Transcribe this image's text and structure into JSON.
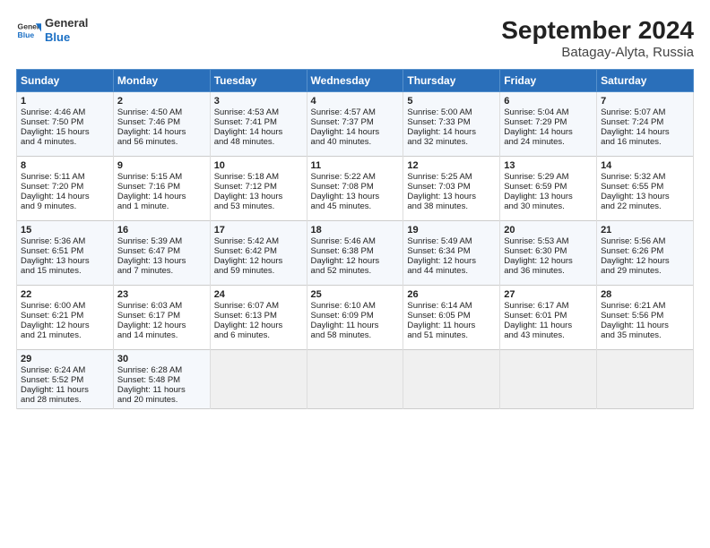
{
  "header": {
    "logo_general": "General",
    "logo_blue": "Blue",
    "month_title": "September 2024",
    "location": "Batagay-Alyta, Russia"
  },
  "weekdays": [
    "Sunday",
    "Monday",
    "Tuesday",
    "Wednesday",
    "Thursday",
    "Friday",
    "Saturday"
  ],
  "weeks": [
    [
      {
        "day": "1",
        "lines": [
          "Sunrise: 4:46 AM",
          "Sunset: 7:50 PM",
          "Daylight: 15 hours",
          "and 4 minutes."
        ]
      },
      {
        "day": "2",
        "lines": [
          "Sunrise: 4:50 AM",
          "Sunset: 7:46 PM",
          "Daylight: 14 hours",
          "and 56 minutes."
        ]
      },
      {
        "day": "3",
        "lines": [
          "Sunrise: 4:53 AM",
          "Sunset: 7:41 PM",
          "Daylight: 14 hours",
          "and 48 minutes."
        ]
      },
      {
        "day": "4",
        "lines": [
          "Sunrise: 4:57 AM",
          "Sunset: 7:37 PM",
          "Daylight: 14 hours",
          "and 40 minutes."
        ]
      },
      {
        "day": "5",
        "lines": [
          "Sunrise: 5:00 AM",
          "Sunset: 7:33 PM",
          "Daylight: 14 hours",
          "and 32 minutes."
        ]
      },
      {
        "day": "6",
        "lines": [
          "Sunrise: 5:04 AM",
          "Sunset: 7:29 PM",
          "Daylight: 14 hours",
          "and 24 minutes."
        ]
      },
      {
        "day": "7",
        "lines": [
          "Sunrise: 5:07 AM",
          "Sunset: 7:24 PM",
          "Daylight: 14 hours",
          "and 16 minutes."
        ]
      }
    ],
    [
      {
        "day": "8",
        "lines": [
          "Sunrise: 5:11 AM",
          "Sunset: 7:20 PM",
          "Daylight: 14 hours",
          "and 9 minutes."
        ]
      },
      {
        "day": "9",
        "lines": [
          "Sunrise: 5:15 AM",
          "Sunset: 7:16 PM",
          "Daylight: 14 hours",
          "and 1 minute."
        ]
      },
      {
        "day": "10",
        "lines": [
          "Sunrise: 5:18 AM",
          "Sunset: 7:12 PM",
          "Daylight: 13 hours",
          "and 53 minutes."
        ]
      },
      {
        "day": "11",
        "lines": [
          "Sunrise: 5:22 AM",
          "Sunset: 7:08 PM",
          "Daylight: 13 hours",
          "and 45 minutes."
        ]
      },
      {
        "day": "12",
        "lines": [
          "Sunrise: 5:25 AM",
          "Sunset: 7:03 PM",
          "Daylight: 13 hours",
          "and 38 minutes."
        ]
      },
      {
        "day": "13",
        "lines": [
          "Sunrise: 5:29 AM",
          "Sunset: 6:59 PM",
          "Daylight: 13 hours",
          "and 30 minutes."
        ]
      },
      {
        "day": "14",
        "lines": [
          "Sunrise: 5:32 AM",
          "Sunset: 6:55 PM",
          "Daylight: 13 hours",
          "and 22 minutes."
        ]
      }
    ],
    [
      {
        "day": "15",
        "lines": [
          "Sunrise: 5:36 AM",
          "Sunset: 6:51 PM",
          "Daylight: 13 hours",
          "and 15 minutes."
        ]
      },
      {
        "day": "16",
        "lines": [
          "Sunrise: 5:39 AM",
          "Sunset: 6:47 PM",
          "Daylight: 13 hours",
          "and 7 minutes."
        ]
      },
      {
        "day": "17",
        "lines": [
          "Sunrise: 5:42 AM",
          "Sunset: 6:42 PM",
          "Daylight: 12 hours",
          "and 59 minutes."
        ]
      },
      {
        "day": "18",
        "lines": [
          "Sunrise: 5:46 AM",
          "Sunset: 6:38 PM",
          "Daylight: 12 hours",
          "and 52 minutes."
        ]
      },
      {
        "day": "19",
        "lines": [
          "Sunrise: 5:49 AM",
          "Sunset: 6:34 PM",
          "Daylight: 12 hours",
          "and 44 minutes."
        ]
      },
      {
        "day": "20",
        "lines": [
          "Sunrise: 5:53 AM",
          "Sunset: 6:30 PM",
          "Daylight: 12 hours",
          "and 36 minutes."
        ]
      },
      {
        "day": "21",
        "lines": [
          "Sunrise: 5:56 AM",
          "Sunset: 6:26 PM",
          "Daylight: 12 hours",
          "and 29 minutes."
        ]
      }
    ],
    [
      {
        "day": "22",
        "lines": [
          "Sunrise: 6:00 AM",
          "Sunset: 6:21 PM",
          "Daylight: 12 hours",
          "and 21 minutes."
        ]
      },
      {
        "day": "23",
        "lines": [
          "Sunrise: 6:03 AM",
          "Sunset: 6:17 PM",
          "Daylight: 12 hours",
          "and 14 minutes."
        ]
      },
      {
        "day": "24",
        "lines": [
          "Sunrise: 6:07 AM",
          "Sunset: 6:13 PM",
          "Daylight: 12 hours",
          "and 6 minutes."
        ]
      },
      {
        "day": "25",
        "lines": [
          "Sunrise: 6:10 AM",
          "Sunset: 6:09 PM",
          "Daylight: 11 hours",
          "and 58 minutes."
        ]
      },
      {
        "day": "26",
        "lines": [
          "Sunrise: 6:14 AM",
          "Sunset: 6:05 PM",
          "Daylight: 11 hours",
          "and 51 minutes."
        ]
      },
      {
        "day": "27",
        "lines": [
          "Sunrise: 6:17 AM",
          "Sunset: 6:01 PM",
          "Daylight: 11 hours",
          "and 43 minutes."
        ]
      },
      {
        "day": "28",
        "lines": [
          "Sunrise: 6:21 AM",
          "Sunset: 5:56 PM",
          "Daylight: 11 hours",
          "and 35 minutes."
        ]
      }
    ],
    [
      {
        "day": "29",
        "lines": [
          "Sunrise: 6:24 AM",
          "Sunset: 5:52 PM",
          "Daylight: 11 hours",
          "and 28 minutes."
        ]
      },
      {
        "day": "30",
        "lines": [
          "Sunrise: 6:28 AM",
          "Sunset: 5:48 PM",
          "Daylight: 11 hours",
          "and 20 minutes."
        ]
      },
      null,
      null,
      null,
      null,
      null
    ]
  ]
}
